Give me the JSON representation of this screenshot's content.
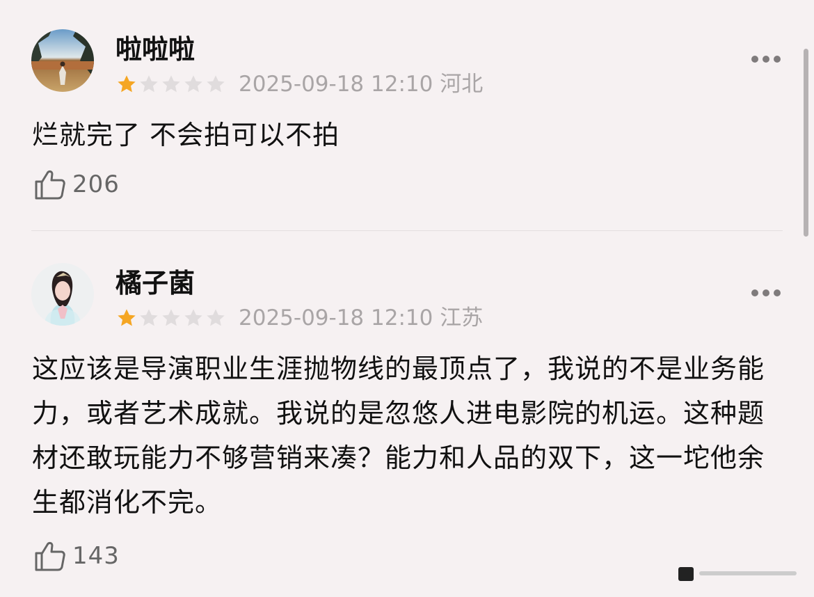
{
  "comments": [
    {
      "username": "啦啦啦",
      "rating": 1,
      "max_rating": 5,
      "timestamp": "2025-09-18 12:10",
      "location": "河北",
      "text": "烂就完了 不会拍可以不拍",
      "likes": "206"
    },
    {
      "username": "橘子菌",
      "rating": 1,
      "max_rating": 5,
      "timestamp": "2025-09-18 12:10",
      "location": "江苏",
      "text": "这应该是导演职业生涯抛物线的最顶点了，我说的不是业务能力，或者艺术成就。我说的是忽悠人进电影院的机运。这种题材还敢玩能力不够营销来凑？能力和人品的双下，这一坨他余生都消化不完。",
      "likes": "143"
    }
  ],
  "colors": {
    "star_filled": "#f5a623",
    "star_empty": "#e0dcdd",
    "meta_text": "#a9a5a6",
    "background": "#f6f1f2"
  },
  "icons": {
    "like": "thumbs-up-icon",
    "more": "more-dots-icon",
    "star": "star-icon"
  }
}
